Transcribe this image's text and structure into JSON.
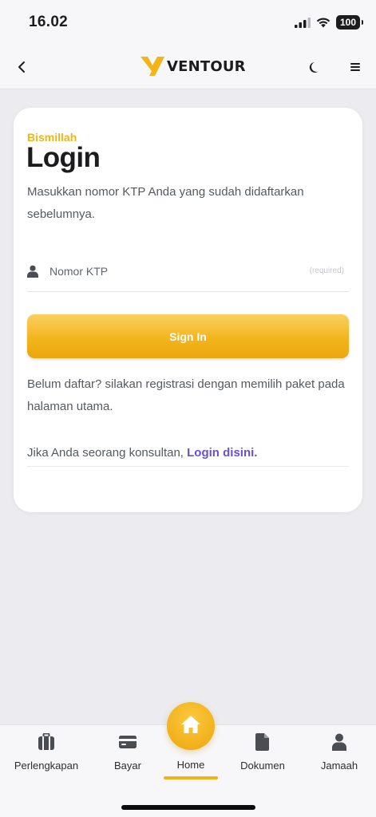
{
  "status_bar": {
    "time": "16.02",
    "battery": "100"
  },
  "header": {
    "brand": "VENTOUR",
    "brand_color": "#f2b416"
  },
  "login": {
    "eyebrow": "Bismillah",
    "title": "Login",
    "description": "Masukkan nomor KTP Anda yang sudah didaftarkan sebelumnya.",
    "ktp_placeholder": "Nomor KTP",
    "ktp_value": "",
    "required_hint": "(required)",
    "signin_label": "Sign In",
    "register_note": "Belum daftar? silakan registrasi dengan memilih paket pada halaman utama.",
    "consultant_prefix": "Jika Anda seorang konsultan,",
    "consultant_link": "Login disini."
  },
  "bottom_nav": {
    "items": [
      {
        "label": "Perlengkapan",
        "icon": "luggage-icon"
      },
      {
        "label": "Bayar",
        "icon": "credit-card-icon"
      },
      {
        "label": "Home",
        "icon": "home-icon",
        "active": true
      },
      {
        "label": "Dokumen",
        "icon": "document-icon"
      },
      {
        "label": "Jamaah",
        "icon": "person-icon"
      }
    ]
  }
}
